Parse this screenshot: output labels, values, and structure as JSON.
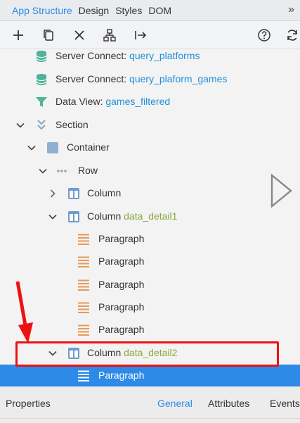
{
  "tabs": [
    {
      "label": "App Structure",
      "active": true
    },
    {
      "label": "Design",
      "active": false
    },
    {
      "label": "Styles",
      "active": false
    },
    {
      "label": "DOM",
      "active": false
    }
  ],
  "more_label": "»",
  "toolbar_icons": [
    "plus-icon",
    "duplicate-icon",
    "close-icon",
    "sitemap-icon",
    "move-to-icon",
    "help-icon",
    "refresh-icon"
  ],
  "tree": [
    {
      "name": "Server Connect: ",
      "binding": "query_platforms",
      "icon": "database-icon",
      "chevron": "none"
    },
    {
      "name": "Server Connect: ",
      "binding": "query_plaform_games",
      "icon": "database-icon",
      "chevron": "none"
    },
    {
      "name": "Data View: ",
      "binding": "games_filtered",
      "icon": "filter-icon",
      "chevron": "none"
    },
    {
      "name": "Section",
      "binding": "",
      "icon": "section-icon",
      "chevron": "down"
    },
    {
      "name": "Container",
      "binding": "",
      "icon": "container-icon",
      "chevron": "down"
    },
    {
      "name": "Row",
      "binding": "",
      "icon": "row-icon",
      "chevron": "down"
    },
    {
      "name": "Column",
      "binding": "",
      "icon": "column-icon",
      "chevron": "right"
    },
    {
      "name": "Column ",
      "binding": "data_detail1",
      "icon": "column-icon",
      "chevron": "down"
    },
    {
      "name": "Paragraph",
      "binding": "",
      "icon": "paragraph-icon",
      "chevron": "none"
    },
    {
      "name": "Paragraph",
      "binding": "",
      "icon": "paragraph-icon",
      "chevron": "none"
    },
    {
      "name": "Paragraph",
      "binding": "",
      "icon": "paragraph-icon",
      "chevron": "none"
    },
    {
      "name": "Paragraph",
      "binding": "",
      "icon": "paragraph-icon",
      "chevron": "none"
    },
    {
      "name": "Paragraph",
      "binding": "",
      "icon": "paragraph-icon",
      "chevron": "none"
    },
    {
      "name": "Column ",
      "binding": "data_detail2",
      "icon": "column-icon",
      "chevron": "down"
    },
    {
      "name": "Paragraph",
      "binding": "",
      "icon": "paragraph-icon",
      "chevron": "none",
      "selected": true
    }
  ],
  "properties": {
    "title": "Properties",
    "tabs": [
      {
        "label": "General",
        "active": true
      },
      {
        "label": "Attributes",
        "active": false
      },
      {
        "label": "Events",
        "active": false
      }
    ]
  },
  "colors": {
    "accent": "#2d8ae6",
    "binding_blue": "#1e8fd9",
    "binding_green": "#8aa83a",
    "annotation_red": "#ee1111"
  }
}
